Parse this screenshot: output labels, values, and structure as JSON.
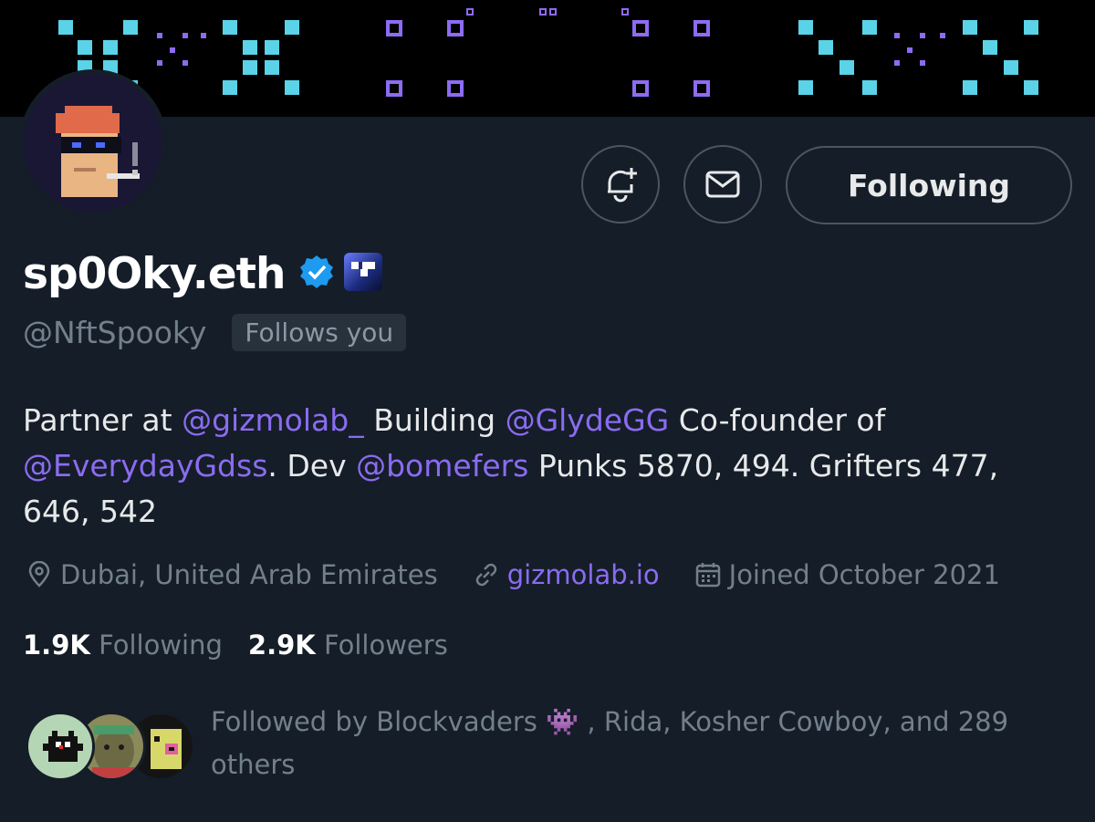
{
  "profile": {
    "display_name": "sp0Oky.eth",
    "handle": "@NftSpooky",
    "follows_you_badge": "Follows you",
    "verified_icon": "verified-badge-icon",
    "affiliate_icon": "affiliate-badge-icon"
  },
  "actions": {
    "notify_icon": "bell-plus-icon",
    "message_icon": "mail-icon",
    "following_label": "Following"
  },
  "bio": {
    "t1": "Partner at ",
    "m1": "@gizmolab_",
    "t2": " Building ",
    "m2": "@GlydeGG",
    "t3": " Co-founder of ",
    "m3": "@EverydayGdss",
    "t4": ". Dev ",
    "m4": "@bomefers",
    "t5": " Punks 5870, 494. Grifters 477, 646, 542"
  },
  "meta": {
    "location": "Dubai, United Arab Emirates",
    "website": "gizmolab.io",
    "joined": "Joined October 2021"
  },
  "counts": {
    "following_count": "1.9K",
    "following_label": "Following",
    "followers_count": "2.9K",
    "followers_label": "Followers"
  },
  "followed_by": {
    "prefix": "Followed by Blockvaders ",
    "emoji": "👾",
    "suffix": " , Rida, Kosher Cowboy, and 289 others"
  },
  "colors": {
    "background": "#151d28",
    "accent": "#8a6cf0",
    "muted": "#72808c",
    "verified": "#1d9bf0"
  }
}
